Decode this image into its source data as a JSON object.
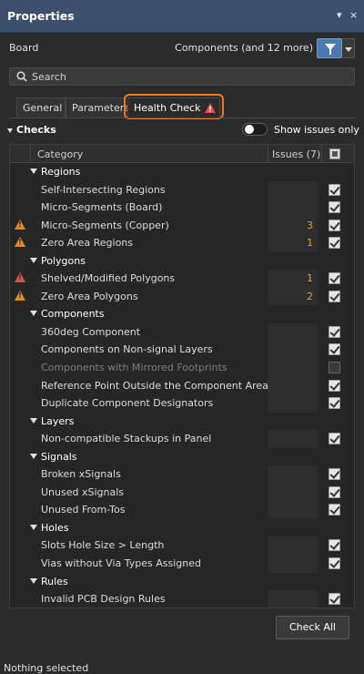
{
  "panel": {
    "title": "Properties",
    "pin": "▾",
    "close": "×"
  },
  "board": {
    "label": "Board",
    "filter_text": "Components (and 12 more)"
  },
  "search": {
    "placeholder": "Search"
  },
  "tabs": [
    {
      "label": "General"
    },
    {
      "label": "Parameters"
    },
    {
      "label": "Health Check"
    }
  ],
  "checks": {
    "title": "Checks",
    "toggle_label": "Show issues only",
    "toggle_on": false
  },
  "table": {
    "headers": {
      "category": "Category",
      "issues": "Issues (7)"
    },
    "rows": [
      {
        "type": "cat",
        "label": "Regions"
      },
      {
        "type": "item",
        "label": "Self-Intersecting Regions",
        "count": "",
        "warn": "",
        "checked": true
      },
      {
        "type": "item",
        "label": "Micro-Segments (Board)",
        "count": "",
        "warn": "",
        "checked": true
      },
      {
        "type": "item",
        "label": "Micro-Segments (Copper)",
        "count": "3",
        "warn": "orange",
        "checked": true
      },
      {
        "type": "item",
        "label": "Zero Area Regions",
        "count": "1",
        "warn": "orange",
        "checked": true
      },
      {
        "type": "cat",
        "label": "Polygons"
      },
      {
        "type": "item",
        "label": "Shelved/Modified Polygons",
        "count": "1",
        "warn": "red",
        "checked": true
      },
      {
        "type": "item",
        "label": "Zero Area Polygons",
        "count": "2",
        "warn": "orange",
        "checked": true
      },
      {
        "type": "cat",
        "label": "Components"
      },
      {
        "type": "item",
        "label": "360deg Component",
        "count": "",
        "warn": "",
        "checked": true
      },
      {
        "type": "item",
        "label": "Components on Non-signal Layers",
        "count": "",
        "warn": "",
        "checked": true
      },
      {
        "type": "item",
        "label": "Components with Mirrored Footprints",
        "count": "",
        "warn": "",
        "checked": false,
        "dim": true
      },
      {
        "type": "item",
        "label": "Reference Point Outside the Component Area",
        "count": "",
        "warn": "",
        "checked": true
      },
      {
        "type": "item",
        "label": "Duplicate Component Designators",
        "count": "",
        "warn": "",
        "checked": true
      },
      {
        "type": "cat",
        "label": "Layers"
      },
      {
        "type": "item",
        "label": "Non-compatible Stackups in Panel",
        "count": "",
        "warn": "",
        "checked": true
      },
      {
        "type": "cat",
        "label": "Signals"
      },
      {
        "type": "item",
        "label": "Broken xSignals",
        "count": "",
        "warn": "",
        "checked": true
      },
      {
        "type": "item",
        "label": "Unused xSignals",
        "count": "",
        "warn": "",
        "checked": true
      },
      {
        "type": "item",
        "label": "Unused From-Tos",
        "count": "",
        "warn": "",
        "checked": true
      },
      {
        "type": "cat",
        "label": "Holes"
      },
      {
        "type": "item",
        "label": "Slots Hole Size > Length",
        "count": "",
        "warn": "",
        "checked": true
      },
      {
        "type": "item",
        "label": "Vias without Via Types Assigned",
        "count": "",
        "warn": "",
        "checked": true
      },
      {
        "type": "cat",
        "label": "Rules"
      },
      {
        "type": "item",
        "label": "Invalid PCB Design Rules",
        "count": "",
        "warn": "",
        "checked": true
      }
    ]
  },
  "buttons": {
    "check_all": "Check All"
  },
  "status": {
    "text": "Nothing selected"
  },
  "colors": {
    "accent": "#f07a19",
    "title_bar": "#3c4f6c",
    "warn_orange": "#e08a2a",
    "warn_red": "#d9544f",
    "count": "#e0a13a"
  }
}
